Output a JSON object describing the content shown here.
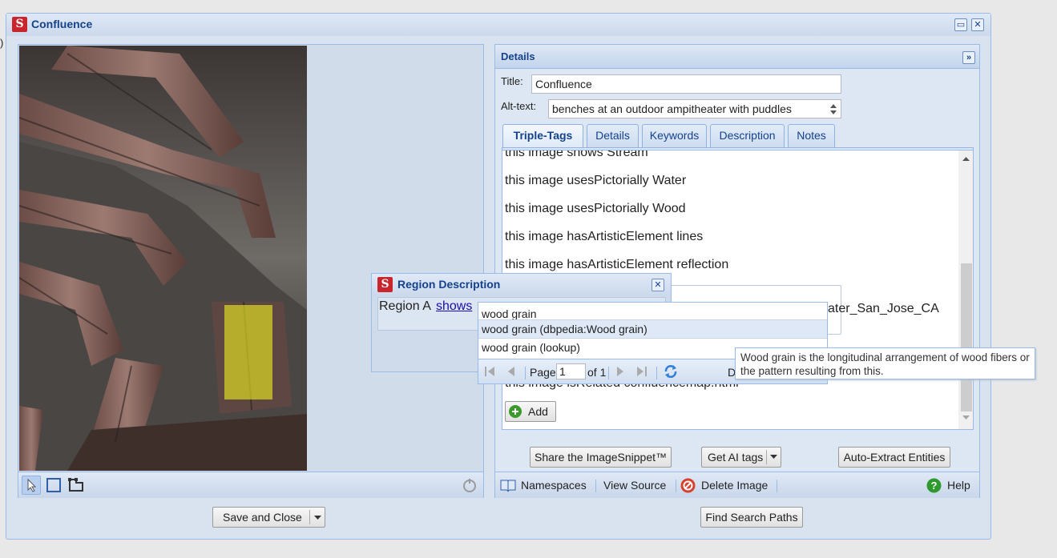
{
  "stray_char": ")",
  "window": {
    "title": "Confluence",
    "logo_text": "S",
    "restore_glyph": "▭",
    "close_glyph": "✕"
  },
  "details": {
    "header": "Details",
    "collapse_glyph": "»",
    "title_label": "Title:",
    "title_value": "Confluence",
    "alt_label": "Alt-text:",
    "alt_value": "benches at an outdoor ampitheater with puddles",
    "tabs": [
      {
        "label": "Triple-Tags",
        "active": true
      },
      {
        "label": "Details",
        "active": false
      },
      {
        "label": "Keywords",
        "active": false
      },
      {
        "label": "Description",
        "active": false
      },
      {
        "label": "Notes",
        "active": false
      }
    ],
    "tags": [
      "this image shows Stream",
      "this image usesPictorially Water",
      "this image usesPictorially Wood",
      "this image hasArtisticElement lines",
      "this image hasArtisticElement reflection",
      "ater_San_Jose_CA",
      "this image isRelated confluencemap.html"
    ],
    "add_label": "Add",
    "buttons": {
      "share": "Share the ImageSnippet™",
      "ai_tags": "Get AI tags",
      "extract": "Auto-Extract Entities"
    },
    "footer": {
      "namespaces": "Namespaces",
      "view_source": "View Source",
      "delete": "Delete Image",
      "help": "Help"
    }
  },
  "region": {
    "title": "Region Description",
    "prefix": "Region A",
    "link": "shows",
    "input_value": "wood grain"
  },
  "autocomplete": {
    "options": [
      "wood grain (dbpedia:Wood grain)",
      "wood grain (lookup)"
    ],
    "page_label": "Page",
    "page_value": "1",
    "of_label": "of 1",
    "trailing": "D"
  },
  "tooltip": {
    "text": "Wood grain is the longitudinal arrangement of wood fibers or the pattern resulting from this."
  },
  "bottom_buttons": {
    "save_close": "Save and Close",
    "find_paths": "Find Search Paths"
  },
  "colors": {
    "accent": "#15428b",
    "logo": "#c8262c",
    "region_highlight": "#f2f21e"
  }
}
